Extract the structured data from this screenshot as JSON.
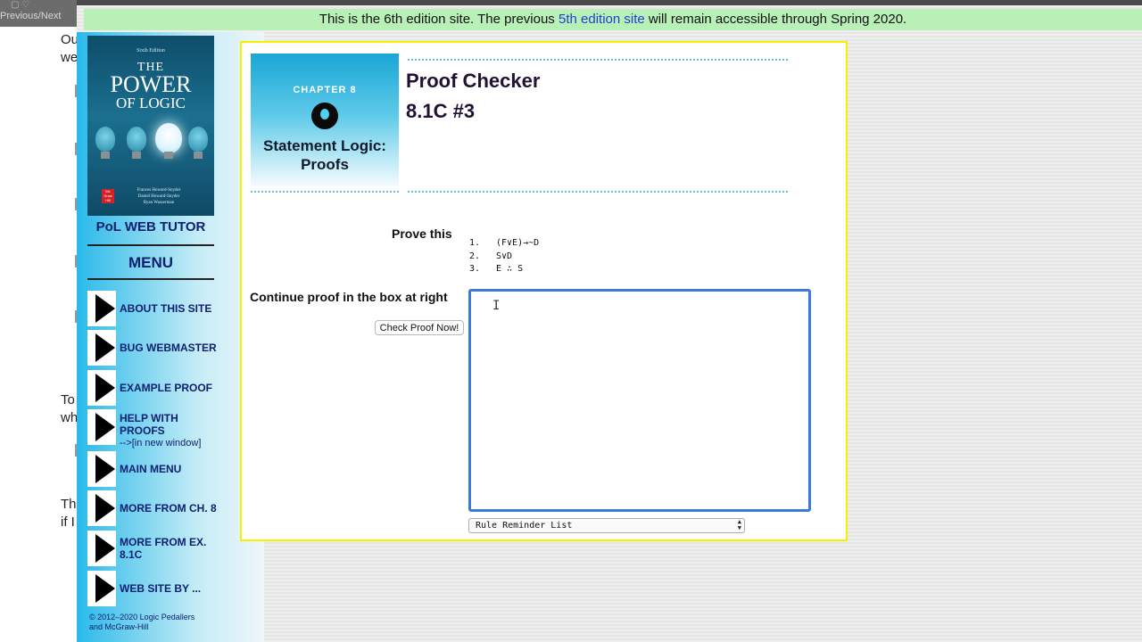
{
  "background_window": {
    "nav_label": "Previous/Next",
    "fragments": [
      "Ou",
      "we",
      "To",
      "wh",
      "Th",
      "if I"
    ]
  },
  "banner": {
    "text_before": "This is the 6th edition site. The previous ",
    "link_text": "5th edition site",
    "text_after": " will remain accessible through Spring 2020."
  },
  "sidebar": {
    "cover": {
      "edition": "Sixth Edition",
      "title_the": "THE",
      "title_power": "POWER",
      "title_logic": "OF LOGIC",
      "authors": [
        "Frances Howard-Snyder",
        "Daniel Howard-Snyder",
        "Ryan Wasserman"
      ],
      "publisher": "Mc Graw Hill"
    },
    "tutor_label": "PoL WEB TUTOR",
    "menu_title": "MENU",
    "items": [
      {
        "label": "ABOUT THIS SITE",
        "sub": ""
      },
      {
        "label": "BUG WEBMASTER",
        "sub": ""
      },
      {
        "label": "EXAMPLE PROOF",
        "sub": ""
      },
      {
        "label": "HELP WITH PROOFS",
        "sub": "-->[in new window]"
      },
      {
        "label": "MAIN MENU",
        "sub": ""
      },
      {
        "label": "MORE FROM CH. 8",
        "sub": ""
      },
      {
        "label": "MORE FROM EX. 8.1C",
        "sub": ""
      },
      {
        "label": "WEB SITE BY ...",
        "sub": ""
      }
    ],
    "copyright_line1": "© 2012–2020 Logic Pedallers",
    "copyright_line2": "and McGraw-Hill"
  },
  "main": {
    "chapter": {
      "number_label": "CHAPTER 8",
      "title_line1": "Statement Logic:",
      "title_line2": "Proofs"
    },
    "heading": "Proof Checker",
    "exercise": "8.1C #3",
    "prove_label": "Prove this",
    "premises": [
      {
        "num": "1.",
        "formula": "(F∨E)→~D"
      },
      {
        "num": "2.",
        "formula": "S∨D"
      },
      {
        "num": "3.",
        "formula": "E ∴ S"
      }
    ],
    "continue_label": "Continue proof in the box at right",
    "check_button": "Check Proof Now!",
    "proof_value": "",
    "rule_select": "Rule Reminder List"
  }
}
